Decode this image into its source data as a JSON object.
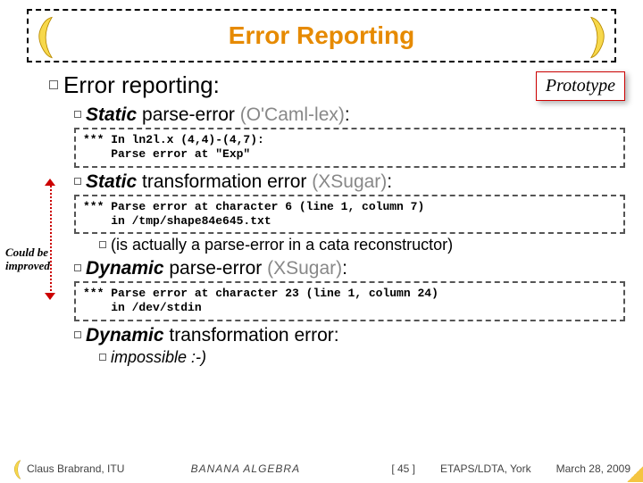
{
  "title": "Error Reporting",
  "prototype_label": "Prototype",
  "main_heading": "Error reporting:",
  "items": {
    "static_parse": {
      "bold": "Static",
      "rest": " parse-error ",
      "gray": "(O'Caml-lex)",
      "colon": ":"
    },
    "code1": "*** In ln2l.x (4,4)-(4,7):\n    Parse error at \"Exp\"",
    "static_trans": {
      "bold": "Static",
      "rest": " transformation error ",
      "gray": "(XSugar)",
      "colon": ":"
    },
    "code2": "*** Parse error at character 6 (line 1, column 7)\n    in /tmp/shape84e645.txt",
    "sub_note": "(is actually a parse-error in a cata reconstructor)",
    "dynamic_parse": {
      "bold": "Dynamic",
      "rest": " parse-error ",
      "gray": "(XSugar)",
      "colon": ":"
    },
    "code3": "*** Parse error at character 23 (line 1, column 24)\n    in /dev/stdin",
    "dynamic_trans": {
      "bold": "Dynamic",
      "rest": " transformation error:"
    },
    "impossible": "impossible :-)"
  },
  "annotation": "Could be improved",
  "footer": {
    "author": "Claus Brabrand, ITU",
    "mid": "BANANA ALGEBRA",
    "page": "[ 45 ]",
    "venue": "ETAPS/LDTA, York",
    "date": "March 28, 2009"
  }
}
